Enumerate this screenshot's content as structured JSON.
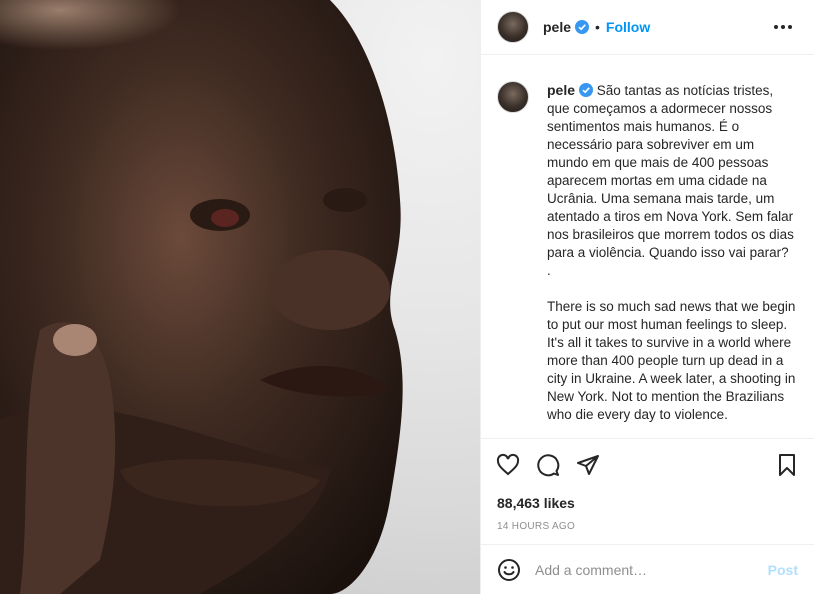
{
  "header": {
    "username": "pele",
    "separator": "•",
    "follow_label": "Follow",
    "verified_icon": "verified-badge-icon",
    "more_icon": "more-options-icon"
  },
  "caption": {
    "username": "pele",
    "text": "São tantas as notícias tristes, que começamos a adormecer nossos sentimentos mais humanos. É o necessário para sobreviver em um mundo em que mais de 400 pessoas aparecem mortas em uma cidade na Ucrânia. Uma semana mais tarde, um atentado a tiros em Nova York. Sem falar nos brasileiros que morrem todos os dias para a violência. Quando isso vai parar?\n.\n\nThere is so much sad news that we begin to put our most human feelings to sleep. It's all it takes to survive in a world where more than 400 people turn up dead in a city in Ukraine. A week later, a shooting in New York. Not to mention the Brazilians who die every day to violence."
  },
  "actions": {
    "like_icon": "heart-icon",
    "comment_icon": "comment-icon",
    "share_icon": "share-icon",
    "save_icon": "bookmark-icon"
  },
  "likes": "88,463 likes",
  "timestamp": "14 HOURS AGO",
  "comment": {
    "emoji_icon": "emoji-icon",
    "placeholder": "Add a comment…",
    "post_label": "Post"
  },
  "colors": {
    "accent": "#0095f6",
    "post_disabled": "#b2dffc",
    "muted": "#8e8e8e"
  }
}
